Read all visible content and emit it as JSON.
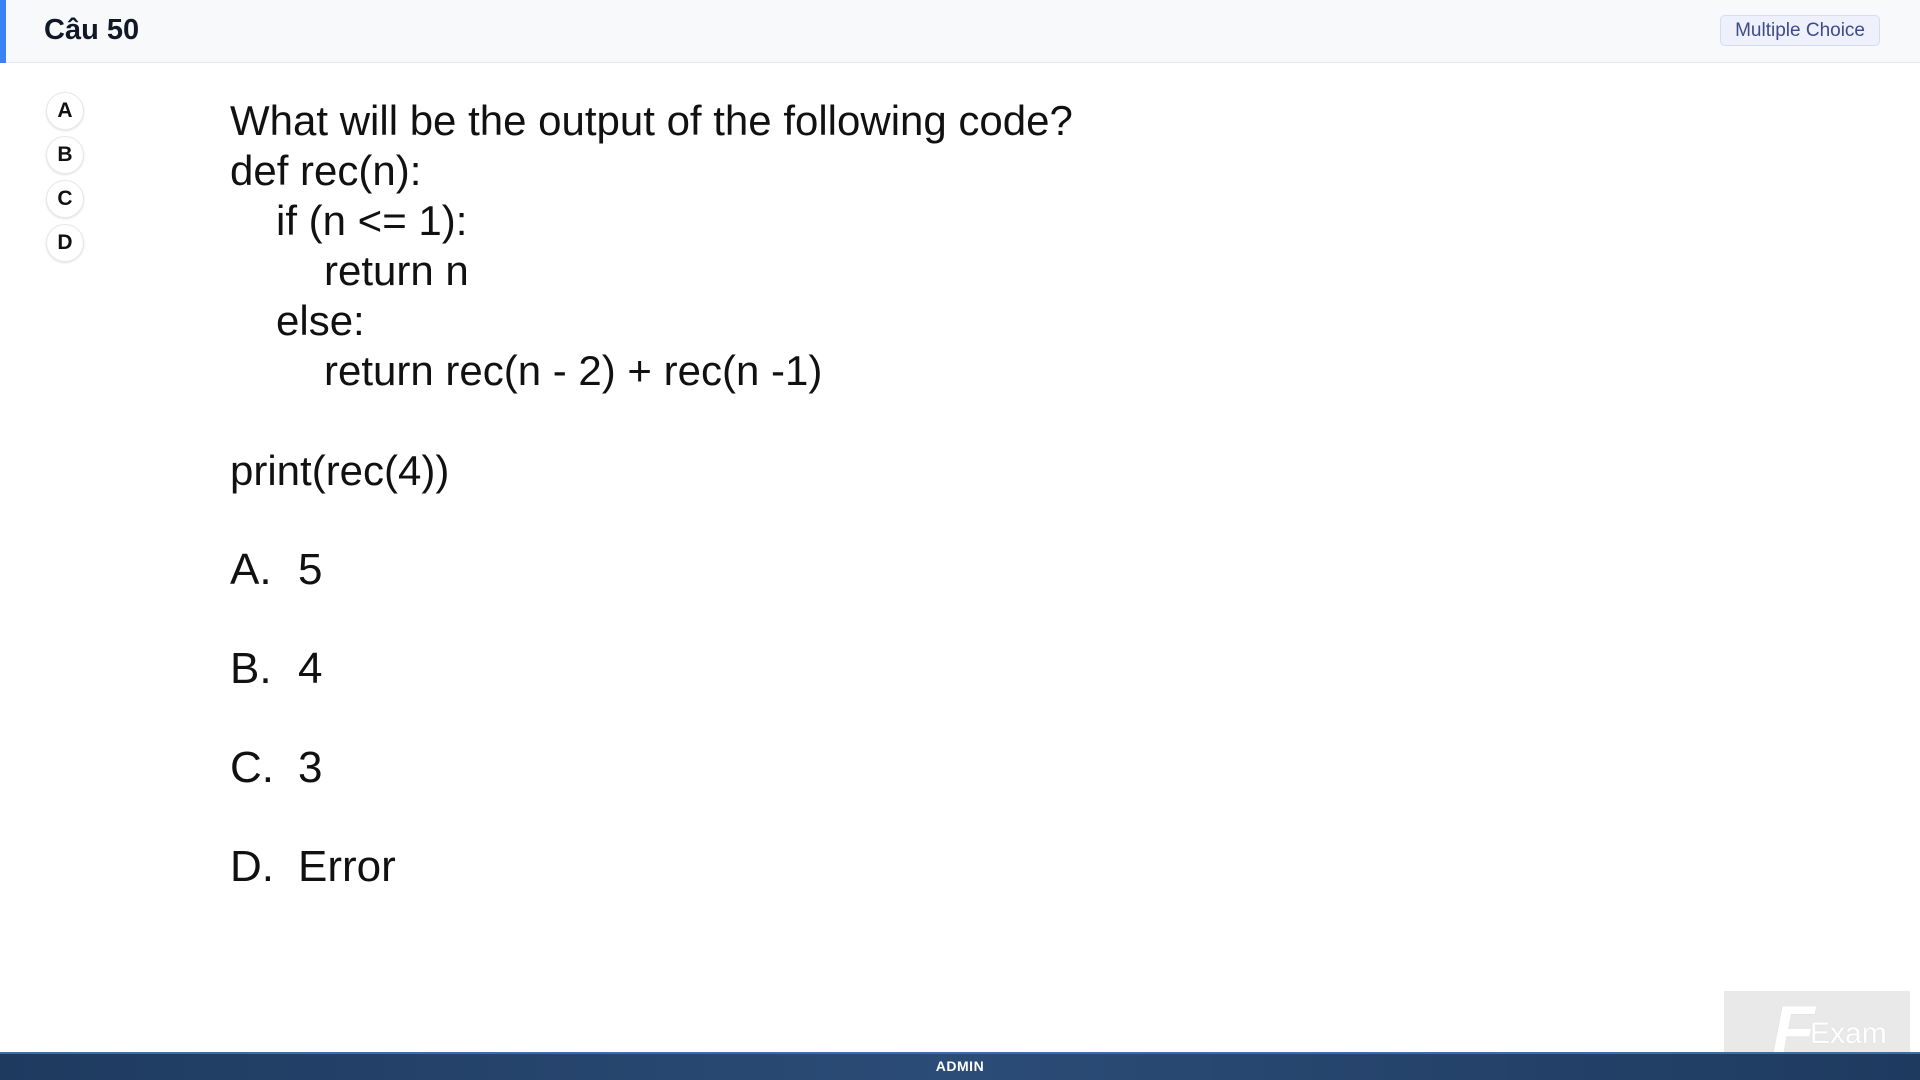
{
  "header": {
    "title": "Câu 50",
    "badge": "Multiple Choice",
    "accent_color": "#3b82f6"
  },
  "options": [
    "A",
    "B",
    "C",
    "D"
  ],
  "question": {
    "prompt": "What will be the output of the following code?",
    "code": [
      "def rec(n):",
      "if (n <= 1):",
      "return n",
      "else:",
      "return rec(n - 2) + rec(n -1)"
    ],
    "call": "print(rec(4))",
    "answers": [
      {
        "letter": "A.",
        "text": "5"
      },
      {
        "letter": "B.",
        "text": "4"
      },
      {
        "letter": "C.",
        "text": "3"
      },
      {
        "letter": "D.",
        "text": "Error"
      }
    ]
  },
  "footer": {
    "text": "ADMIN"
  },
  "watermark": {
    "letter": "F",
    "text": "Exam"
  }
}
